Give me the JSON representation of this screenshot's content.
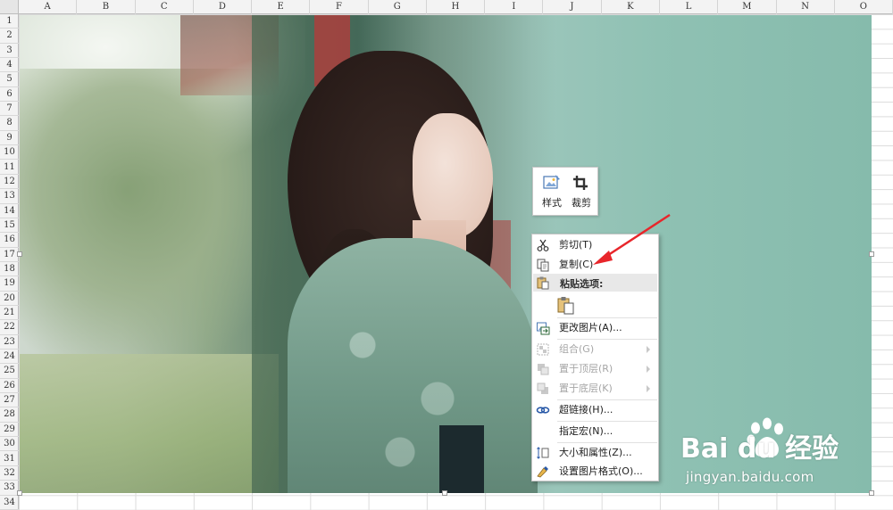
{
  "spreadsheet": {
    "columns": [
      "A",
      "B",
      "C",
      "D",
      "E",
      "F",
      "G",
      "H",
      "I",
      "J",
      "K",
      "L",
      "M",
      "N",
      "O"
    ],
    "rows": [
      "1",
      "2",
      "3",
      "4",
      "5",
      "6",
      "7",
      "8",
      "9",
      "10",
      "11",
      "12",
      "13",
      "14",
      "15",
      "16",
      "17",
      "18",
      "19",
      "20",
      "21",
      "22",
      "23",
      "24",
      "25",
      "26",
      "27",
      "28",
      "29",
      "30",
      "31",
      "32",
      "33",
      "34"
    ]
  },
  "mini_toolbar": {
    "style_label": "样式",
    "crop_label": "裁剪"
  },
  "context_menu": {
    "cut": "剪切(T)",
    "copy": "复制(C)",
    "paste_options_header": "粘贴选项:",
    "change_picture": "更改图片(A)...",
    "group": "组合(G)",
    "bring_to_front": "置于顶层(R)",
    "send_to_back": "置于底层(K)",
    "hyperlink": "超链接(H)...",
    "assign_macro": "指定宏(N)...",
    "size_properties": "大小和属性(Z)...",
    "format_picture": "设置图片格式(O)..."
  },
  "watermark": {
    "logo_text": "Bai du 经验",
    "url": "jingyan.baidu.com"
  },
  "colors": {
    "arrow": "#e8262b",
    "menu_header_bg": "#e8e8e8",
    "disabled_text": "#a6a6a6"
  }
}
